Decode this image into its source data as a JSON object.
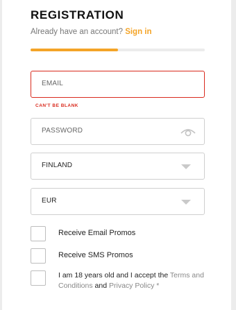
{
  "registration": {
    "title": "REGISTRATION",
    "subtitle_prefix": "Already have an account?",
    "signin_link": "Sign in",
    "progress": 0.5,
    "accent_color": "#f4a428",
    "error_color": "#d9291c"
  },
  "fields": {
    "email": {
      "placeholder": "EMAIL",
      "error": "CAN'T BE BLANK"
    },
    "password": {
      "placeholder": "PASSWORD",
      "icon": "eye-icon"
    },
    "country": {
      "value": "FINLAND",
      "icon": "caret-down-icon"
    },
    "currency": {
      "value": "EUR",
      "icon": "caret-down-icon"
    }
  },
  "checkboxes": {
    "email_promos": "Receive Email Promos",
    "sms_promos": "Receive SMS Promos",
    "terms": {
      "prefix": "I am 18 years old and I accept the",
      "terms_link": "Terms and Conditions",
      "and": "and",
      "privacy_link": "Privacy Policy",
      "suffix": "*"
    }
  }
}
